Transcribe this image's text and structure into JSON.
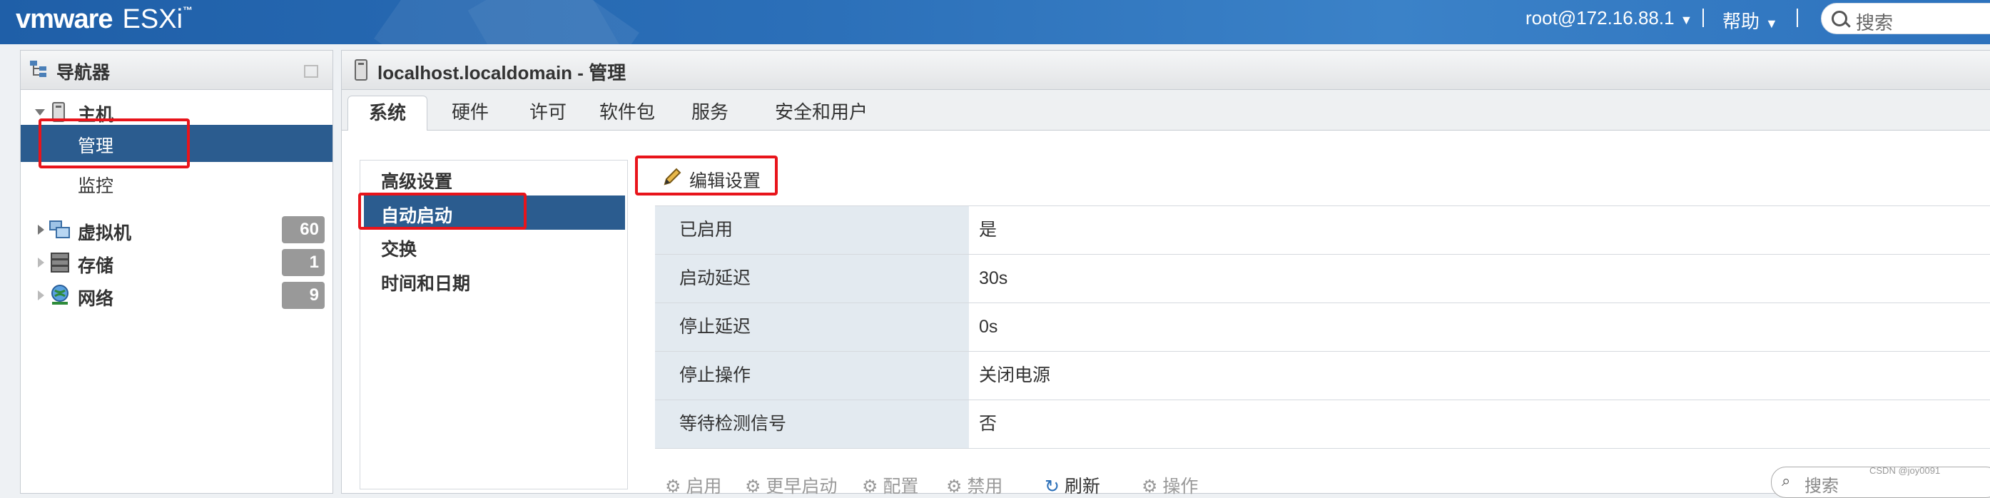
{
  "topbar": {
    "logo_vm": "vmware",
    "logo_product": "ESXi",
    "user": "root@172.16.88.1",
    "help": "帮助",
    "search_placeholder": "搜索"
  },
  "navigator": {
    "title": "导航器",
    "host": "主机",
    "manage": "管理",
    "monitor": "监控",
    "vms": {
      "label": "虚拟机",
      "count": "60"
    },
    "storage": {
      "label": "存储",
      "count": "1"
    },
    "network": {
      "label": "网络",
      "count": "9"
    }
  },
  "main": {
    "title": "localhost.localdomain - 管理",
    "tabs": [
      "系统",
      "硬件",
      "许可",
      "软件包",
      "服务",
      "安全和用户"
    ],
    "active_tab": "系统",
    "subnav": [
      "高级设置",
      "自动启动",
      "交换",
      "时间和日期"
    ],
    "active_subnav": "自动启动",
    "edit_label": "编辑设置",
    "rows": [
      {
        "key": "已启用",
        "value": "是"
      },
      {
        "key": "启动延迟",
        "value": "30s"
      },
      {
        "key": "停止延迟",
        "value": "0s"
      },
      {
        "key": "停止操作",
        "value": "关闭电源"
      },
      {
        "key": "等待检测信号",
        "value": "否"
      }
    ],
    "toolbar": [
      "启用",
      "更早启动",
      "配置",
      "禁用",
      "刷新",
      "操作"
    ],
    "search_placeholder": "搜索"
  },
  "watermark": "CSDN @joy0091",
  "colors": {
    "accent": "#2b5c8f",
    "highlight_box": "#e8141b",
    "topbar": "#2b6fb8"
  }
}
